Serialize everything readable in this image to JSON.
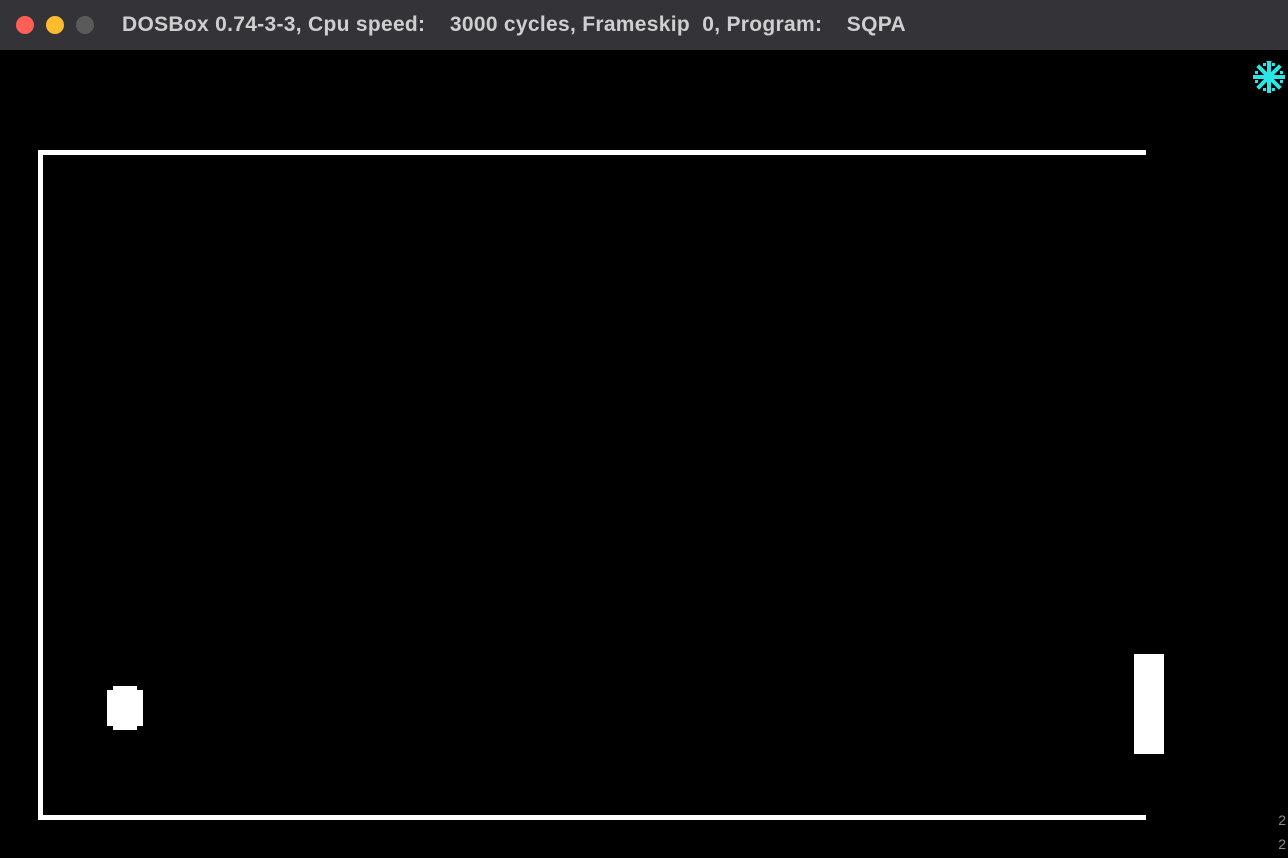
{
  "titlebar": {
    "close_label": "close",
    "minimize_label": "minimize",
    "maximize_label": "maximize",
    "title": "DOSBox 0.74-3-3, Cpu speed:    3000 cycles, Frameskip  0, Program:    SQPA"
  },
  "game": {
    "snowflake_icon": "snowflake",
    "ball_name": "ball",
    "paddle_name": "paddle",
    "frame_name": "game-frame"
  },
  "edge_marks": {
    "mark1": "2",
    "mark2": "2"
  }
}
